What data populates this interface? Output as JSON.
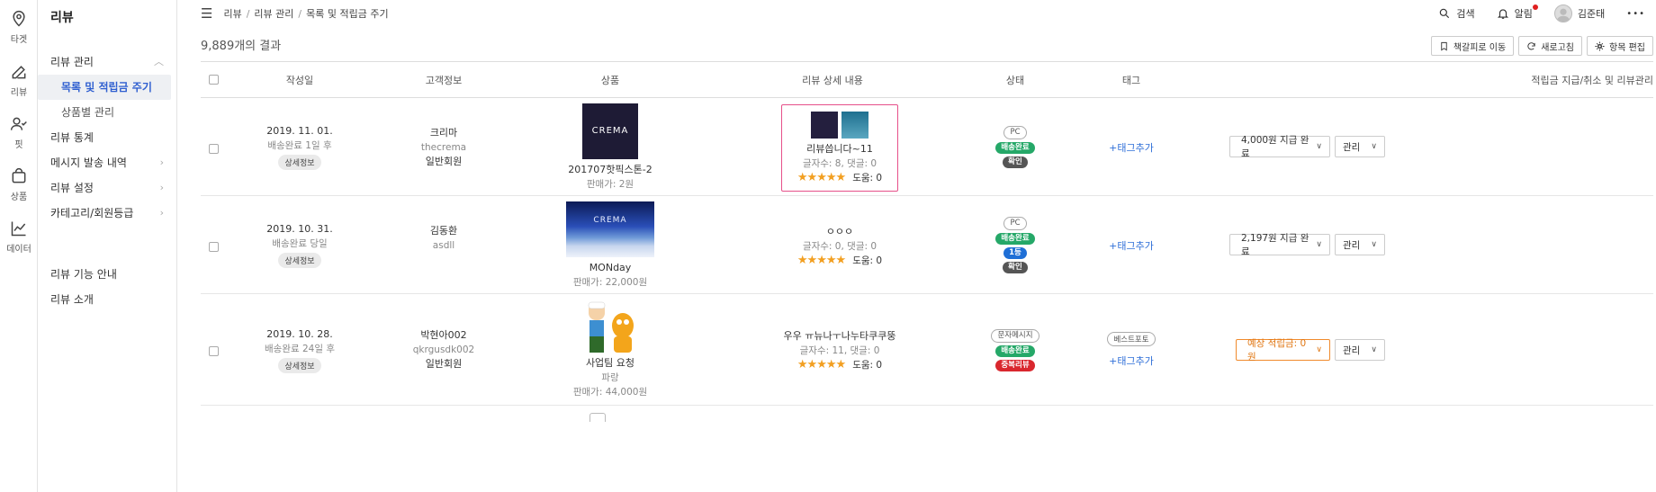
{
  "rail": [
    {
      "label": "타겟",
      "icon": "map-pin-icon"
    },
    {
      "label": "리뷰",
      "icon": "edit-icon"
    },
    {
      "label": "핏",
      "icon": "user-check-icon"
    },
    {
      "label": "상품",
      "icon": "shopping-bag-icon"
    },
    {
      "label": "데이터",
      "icon": "chart-line-icon"
    }
  ],
  "sidebar": {
    "title": "리뷰",
    "items": [
      {
        "label": "리뷰 관리",
        "type": "group",
        "chevron": "up"
      },
      {
        "label": "목록 및 적립금 주기",
        "type": "child",
        "active": true
      },
      {
        "label": "상품별 관리",
        "type": "child"
      },
      {
        "label": "리뷰 통계",
        "type": "item"
      },
      {
        "label": "메시지 발송 내역",
        "type": "item",
        "chevron": "right"
      },
      {
        "label": "리뷰 설정",
        "type": "item",
        "chevron": "right"
      },
      {
        "label": "카테고리/회원등급",
        "type": "item",
        "chevron": "right"
      }
    ],
    "footer": [
      {
        "label": "리뷰 기능 안내"
      },
      {
        "label": "리뷰 소개"
      }
    ]
  },
  "breadcrumb": [
    "리뷰",
    "리뷰 관리",
    "목록 및 적립금 주기"
  ],
  "topbar": {
    "search": "검색",
    "alarm": "알림",
    "user": "김준태",
    "more": "•••"
  },
  "results": {
    "count": "9,889개의 결과"
  },
  "actions": {
    "bookmark": "책갈피로 이동",
    "refresh": "새로고침",
    "edit_columns": "항목 편집"
  },
  "table": {
    "headers": [
      "작성일",
      "고객정보",
      "상품",
      "리뷰 상세 내용",
      "상태",
      "태그",
      "적립금 지급/취소 및 리뷰관리"
    ],
    "rows": [
      {
        "date": "2019. 11. 01.",
        "delivery": "배송완료 1일 후",
        "detail_chip": "상세정보",
        "customer": [
          "크리마",
          "thecrema",
          "일반회원"
        ],
        "product_name": "201707핫픽스톤-2",
        "product_price": "판매가: 2원",
        "product_img_text": "CREMA",
        "review_title": "리뷰씁니다~11",
        "review_meta": "글자수: 8, 댓글: 0",
        "help": "도움: 0",
        "badges": [
          {
            "text": "PC",
            "kind": "pc"
          },
          {
            "text": "배송완료",
            "kind": "green"
          },
          {
            "text": "확인",
            "kind": "dark"
          }
        ],
        "tag_chip": "",
        "tag_add": "+태그추가",
        "points": "4,000원 지급 완료",
        "manage": "관리"
      },
      {
        "date": "2019. 10. 31.",
        "delivery": "배송완료 당일",
        "detail_chip": "상세정보",
        "customer": [
          "김동환",
          "asdll",
          ""
        ],
        "product_name": "MONday",
        "product_price": "판매가: 22,000원",
        "product_img_text": "CREMA",
        "review_title": "ㅇㅇㅇ",
        "review_meta": "글자수: 0, 댓글: 0",
        "help": "도움: 0",
        "badges": [
          {
            "text": "PC",
            "kind": "pc"
          },
          {
            "text": "배송완료",
            "kind": "green"
          },
          {
            "text": "1등",
            "kind": "blue"
          },
          {
            "text": "확인",
            "kind": "dark"
          }
        ],
        "tag_chip": "",
        "tag_add": "+태그추가",
        "points": "2,197원 지급 완료",
        "manage": "관리"
      },
      {
        "date": "2019. 10. 28.",
        "delivery": "배송완료 24일 후",
        "detail_chip": "상세정보",
        "customer": [
          "박현아002",
          "qkrgusdk002",
          "일반회원"
        ],
        "product_name": "사업팀 요청",
        "product_option": "파랑",
        "product_price": "판매가: 44,000원",
        "review_title": "우우 ㅠ뉴나ㅜ나누타쿠쿠뚱",
        "review_meta": "글자수: 11, 댓글: 0",
        "help": "도움: 0",
        "badges": [
          {
            "text": "문자메시지",
            "kind": "pc"
          },
          {
            "text": "배송완료",
            "kind": "green"
          },
          {
            "text": "중복리뷰",
            "kind": "red"
          }
        ],
        "tag_chip": "베스트포토",
        "tag_add": "+태그추가",
        "points": "예상 적립금: 0원",
        "manage": "관리"
      }
    ]
  },
  "stars": "★★★★★",
  "colors": {
    "accent_blue": "#2f5fd0",
    "highlight_pink": "#e6508a",
    "star": "#f29f21",
    "orange": "#f08a2c"
  }
}
